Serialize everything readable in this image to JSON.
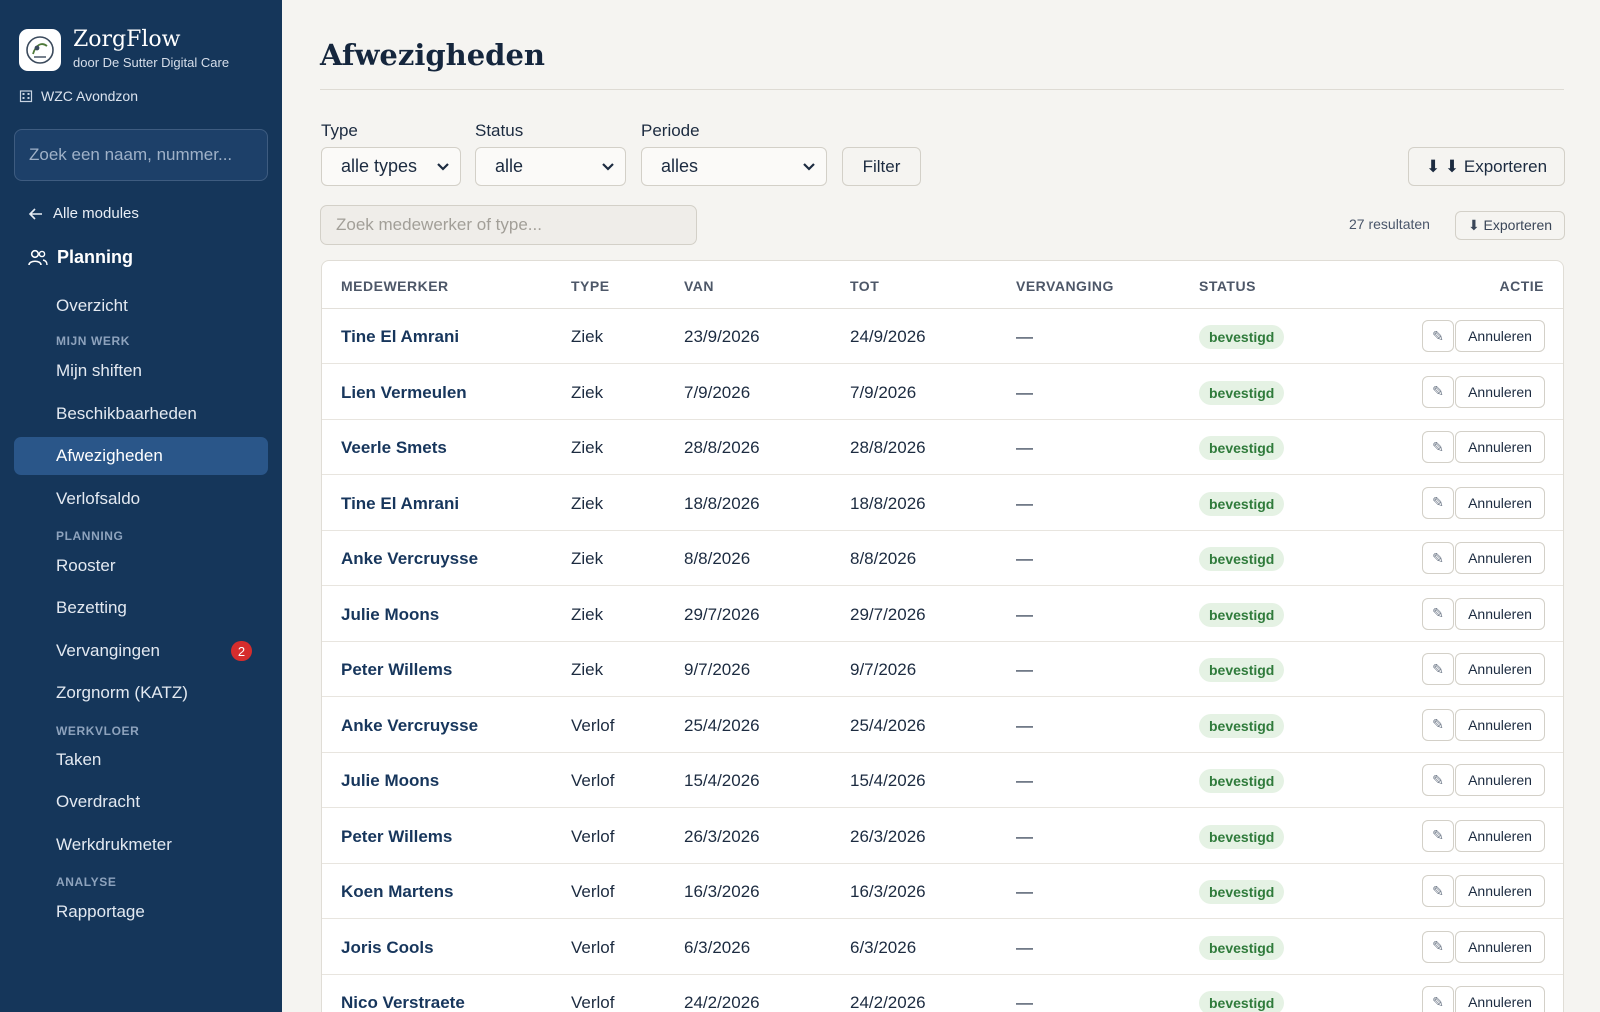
{
  "brand": {
    "name": "ZorgFlow",
    "subtitle": "door De Sutter Digital Care"
  },
  "org": {
    "name": "WZC Avondzon"
  },
  "sidebar": {
    "search_placeholder": "Zoek een naam, nummer...",
    "back_label": "Alle modules",
    "section_label": "Planning",
    "items": [
      {
        "label": "Overzicht"
      },
      {
        "group": "MIJN WERK"
      },
      {
        "label": "Mijn shiften"
      },
      {
        "label": "Beschikbaarheden"
      },
      {
        "label": "Afwezigheden",
        "active": true
      },
      {
        "label": "Verlofsaldo"
      },
      {
        "group": "PLANNING"
      },
      {
        "label": "Rooster"
      },
      {
        "label": "Bezetting"
      },
      {
        "label": "Vervangingen",
        "badge": "2"
      },
      {
        "label": "Zorgnorm (KATZ)"
      },
      {
        "group": "WERKVLOER"
      },
      {
        "label": "Taken"
      },
      {
        "label": "Overdracht"
      },
      {
        "label": "Werkdrukmeter"
      },
      {
        "group": "ANALYSE"
      },
      {
        "label": "Rapportage"
      }
    ]
  },
  "page": {
    "title": "Afwezigheden"
  },
  "filters": {
    "type_label": "Type",
    "type_value": "alle types",
    "status_label": "Status",
    "status_value": "alle",
    "periode_label": "Periode",
    "periode_value": "alles",
    "filter_button": "Filter",
    "export_button": "⬇ ⬇ Exporteren"
  },
  "table_tools": {
    "search_placeholder": "Zoek medewerker of type...",
    "result_count": "27 resultaten",
    "export_button": "⬇ Exporteren"
  },
  "table": {
    "columns": [
      "MEDEWERKER",
      "TYPE",
      "VAN",
      "TOT",
      "VERVANGING",
      "STATUS",
      "ACTIE"
    ],
    "edit_glyph": "✎",
    "cancel_label": "Annuleren",
    "rows": [
      {
        "medewerker": "Tine El Amrani",
        "type": "Ziek",
        "van": "23/9/2026",
        "tot": "24/9/2026",
        "vervanging": "—",
        "status": "bevestigd"
      },
      {
        "medewerker": "Lien Vermeulen",
        "type": "Ziek",
        "van": "7/9/2026",
        "tot": "7/9/2026",
        "vervanging": "—",
        "status": "bevestigd"
      },
      {
        "medewerker": "Veerle Smets",
        "type": "Ziek",
        "van": "28/8/2026",
        "tot": "28/8/2026",
        "vervanging": "—",
        "status": "bevestigd"
      },
      {
        "medewerker": "Tine El Amrani",
        "type": "Ziek",
        "van": "18/8/2026",
        "tot": "18/8/2026",
        "vervanging": "—",
        "status": "bevestigd"
      },
      {
        "medewerker": "Anke Vercruysse",
        "type": "Ziek",
        "van": "8/8/2026",
        "tot": "8/8/2026",
        "vervanging": "—",
        "status": "bevestigd"
      },
      {
        "medewerker": "Julie Moons",
        "type": "Ziek",
        "van": "29/7/2026",
        "tot": "29/7/2026",
        "vervanging": "—",
        "status": "bevestigd"
      },
      {
        "medewerker": "Peter Willems",
        "type": "Ziek",
        "van": "9/7/2026",
        "tot": "9/7/2026",
        "vervanging": "—",
        "status": "bevestigd"
      },
      {
        "medewerker": "Anke Vercruysse",
        "type": "Verlof",
        "van": "25/4/2026",
        "tot": "25/4/2026",
        "vervanging": "—",
        "status": "bevestigd"
      },
      {
        "medewerker": "Julie Moons",
        "type": "Verlof",
        "van": "15/4/2026",
        "tot": "15/4/2026",
        "vervanging": "—",
        "status": "bevestigd"
      },
      {
        "medewerker": "Peter Willems",
        "type": "Verlof",
        "van": "26/3/2026",
        "tot": "26/3/2026",
        "vervanging": "—",
        "status": "bevestigd"
      },
      {
        "medewerker": "Koen Martens",
        "type": "Verlof",
        "van": "16/3/2026",
        "tot": "16/3/2026",
        "vervanging": "—",
        "status": "bevestigd"
      },
      {
        "medewerker": "Joris Cools",
        "type": "Verlof",
        "van": "6/3/2026",
        "tot": "6/3/2026",
        "vervanging": "—",
        "status": "bevestigd"
      },
      {
        "medewerker": "Nico Verstraete",
        "type": "Verlof",
        "van": "24/2/2026",
        "tot": "24/2/2026",
        "vervanging": "—",
        "status": "bevestigd"
      }
    ]
  },
  "colors": {
    "sidebar": "#15365a",
    "active_nav": "#2a5689",
    "badge": "#d62d2d",
    "status_bg": "#e5f2e4",
    "status_text": "#2f7b3b"
  }
}
